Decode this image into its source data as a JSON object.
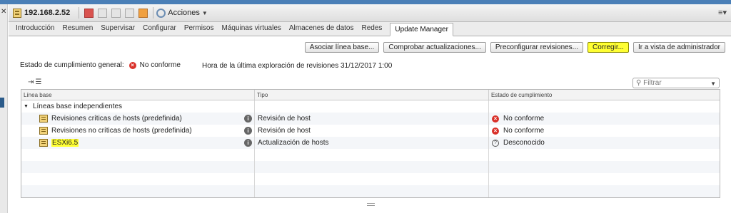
{
  "toolbar": {
    "host": "192.168.2.52",
    "actions_label": "Acciones",
    "right_label": "≡▾"
  },
  "tabs": [
    {
      "label": "Introducción"
    },
    {
      "label": "Resumen"
    },
    {
      "label": "Supervisar"
    },
    {
      "label": "Configurar"
    },
    {
      "label": "Permisos"
    },
    {
      "label": "Máquinas virtuales"
    },
    {
      "label": "Almacenes de datos"
    },
    {
      "label": "Redes"
    },
    {
      "label": "Update Manager",
      "active": true
    }
  ],
  "buttons": {
    "attach": "Asociar línea base...",
    "check": "Comprobar actualizaciones...",
    "prestage": "Preconfigurar revisiones...",
    "remediate": "Corregir...",
    "admin": "Ir a vista de administrador"
  },
  "status": {
    "label": "Estado de cumplimiento general:",
    "value": "No conforme",
    "last_scan": "Hora de la última exploración de revisiones  31/12/2017 1:00"
  },
  "filter": {
    "placeholder": "Filtrar"
  },
  "grid": {
    "columns": [
      "Línea base",
      "Tipo",
      "Estado de cumplimiento"
    ],
    "group": "Líneas base independientes",
    "rows": [
      {
        "name": "Revisiones críticas de hosts (predefinida)",
        "type": "Revisión de host",
        "status": "No conforme",
        "status_kind": "error"
      },
      {
        "name": "Revisiones no críticas de hosts (predefinida)",
        "type": "Revisión de host",
        "status": "No conforme",
        "status_kind": "error"
      },
      {
        "name": "ESXi6.5",
        "type": "Actualización de hosts",
        "status": "Desconocido",
        "status_kind": "unknown"
      }
    ]
  },
  "colors": {
    "highlight": "#ffff33",
    "error": "#d9312a",
    "accent": "#4a7fb7"
  }
}
